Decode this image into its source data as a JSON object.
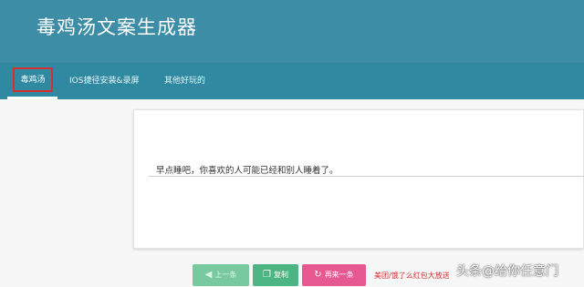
{
  "header": {
    "title": "毒鸡汤文案生成器"
  },
  "nav": {
    "tabs": [
      {
        "label": "毒鸡汤"
      },
      {
        "label": "IOS捷径安装&录屏"
      },
      {
        "label": "其他好玩的"
      }
    ]
  },
  "main": {
    "quote": "早点睡吧，你喜欢的人可能已经和别人睡着了。"
  },
  "actions": {
    "prev_label": "上一条",
    "copy_label": "复制",
    "next_label": "再来一条",
    "promo_text": "美团/饿了么红包大放送"
  },
  "watermark": "头条@给你任意门",
  "colors": {
    "header_bg": "#3d8da6",
    "nav_bg": "#2f8aa1",
    "prev_button": "#79c9a0",
    "copy_button": "#4db583",
    "next_button": "#e65890",
    "promo_text": "#d62f2f",
    "highlight_border": "#d62f2f"
  },
  "icons": {
    "prev": "arrow-left-icon",
    "copy": "copy-icon",
    "next": "refresh-icon"
  }
}
